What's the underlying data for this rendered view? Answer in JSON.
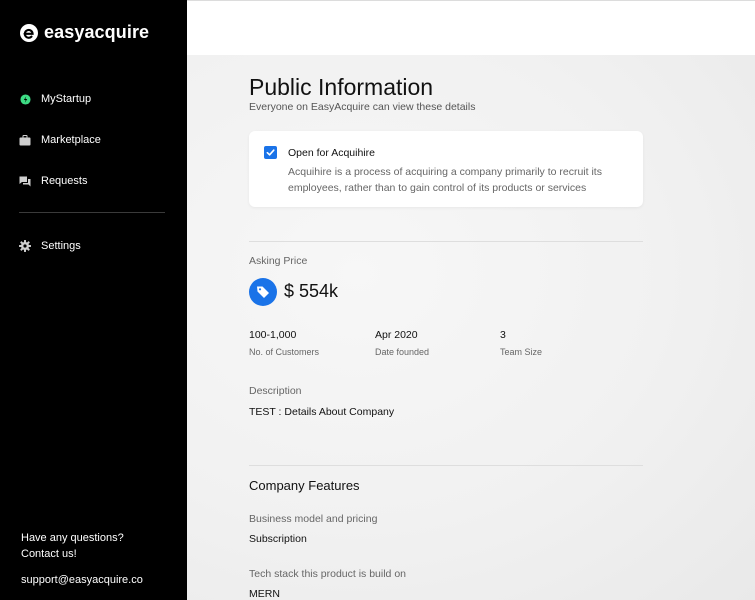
{
  "brand": {
    "name": "easyacquire"
  },
  "sidebar": {
    "items": [
      {
        "label": "MyStartup",
        "icon": "leaf-icon",
        "active": true
      },
      {
        "label": "Marketplace",
        "icon": "briefcase-icon"
      },
      {
        "label": "Requests",
        "icon": "chat-icon"
      },
      {
        "label": "Settings",
        "icon": "gear-icon"
      }
    ],
    "help_line1": "Have any questions?",
    "help_line2": "Contact us!",
    "support_email": "support@easyacquire.co"
  },
  "page": {
    "title": "Public Information",
    "subtitle": "Everyone on EasyAcquire can view these details"
  },
  "acquihire": {
    "checked": true,
    "label": "Open for Acquihire",
    "description": "Acquihire is a process of acquiring a company primarily to recruit its employees, rather than to gain control of its products or services"
  },
  "asking_price": {
    "label": "Asking Price",
    "value": "$ 554k"
  },
  "stats": [
    {
      "value": "100-1,000",
      "label": "No. of Customers"
    },
    {
      "value": "Apr 2020",
      "label": "Date founded"
    },
    {
      "value": "3",
      "label": "Team Size"
    }
  ],
  "description": {
    "label": "Description",
    "value": "TEST : Details About Company"
  },
  "features": {
    "title": "Company Features",
    "business_model_label": "Business model and pricing",
    "business_model_value": "Subscription",
    "tech_stack_label": "Tech stack this product is build on",
    "tech_stack_value": "MERN"
  },
  "colors": {
    "sidebar_bg": "#000000",
    "accent": "#1a73e8",
    "active_icon": "#3ddc84"
  }
}
